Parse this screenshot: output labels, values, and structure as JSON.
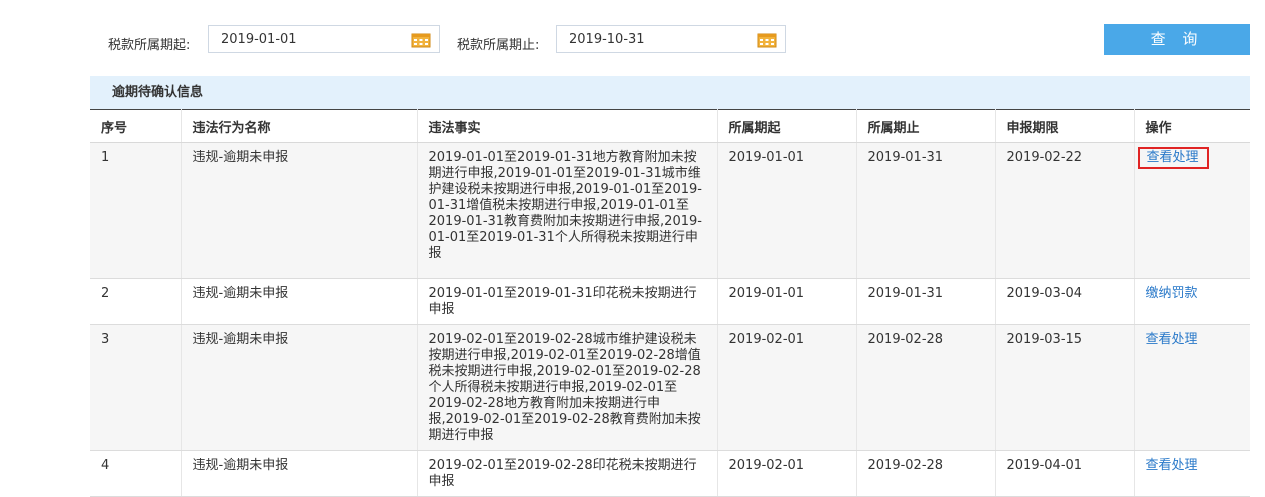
{
  "filter": {
    "start_label": "税款所属期起:",
    "start_value": "2019-01-01",
    "end_label": "税款所属期止:",
    "end_value": "2019-10-31",
    "query_button": "查 询",
    "calendar_icon": "calendar-icon"
  },
  "table": {
    "caption": "逾期待确认信息",
    "headers": [
      "序号",
      "违法行为名称",
      "违法事实",
      "所属期起",
      "所属期止",
      "申报期限",
      "操作"
    ],
    "rows": [
      {
        "no": "1",
        "name": "违规-逾期未申报",
        "fact": "2019-01-01至2019-01-31地方教育附加未按期进行申报,2019-01-01至2019-01-31城市维护建设税未按期进行申报,2019-01-01至2019-01-31增值税未按期进行申报,2019-01-01至2019-01-31教育费附加未按期进行申报,2019-01-01至2019-01-31个人所得税未按期进行申报",
        "start": "2019-01-01",
        "end": "2019-01-31",
        "deadline": "2019-02-22",
        "action": "查看处理"
      },
      {
        "no": "2",
        "name": "违规-逾期未申报",
        "fact": "2019-01-01至2019-01-31印花税未按期进行申报",
        "start": "2019-01-01",
        "end": "2019-01-31",
        "deadline": "2019-03-04",
        "action": "缴纳罚款"
      },
      {
        "no": "3",
        "name": "违规-逾期未申报",
        "fact": "2019-02-01至2019-02-28城市维护建设税未按期进行申报,2019-02-01至2019-02-28增值税未按期进行申报,2019-02-01至2019-02-28个人所得税未按期进行申报,2019-02-01至2019-02-28地方教育附加未按期进行申报,2019-02-01至2019-02-28教育费附加未按期进行申报",
        "start": "2019-02-01",
        "end": "2019-02-28",
        "deadline": "2019-03-15",
        "action": "查看处理"
      },
      {
        "no": "4",
        "name": "违规-逾期未申报",
        "fact": "2019-02-01至2019-02-28印花税未按期进行申报",
        "start": "2019-02-01",
        "end": "2019-02-28",
        "deadline": "2019-04-01",
        "action": "查看处理"
      }
    ]
  },
  "colors": {
    "accent": "#4aa8e8",
    "link": "#2a79c9",
    "highlight_border": "#e02424",
    "caption_bg": "#e3f1fc"
  }
}
